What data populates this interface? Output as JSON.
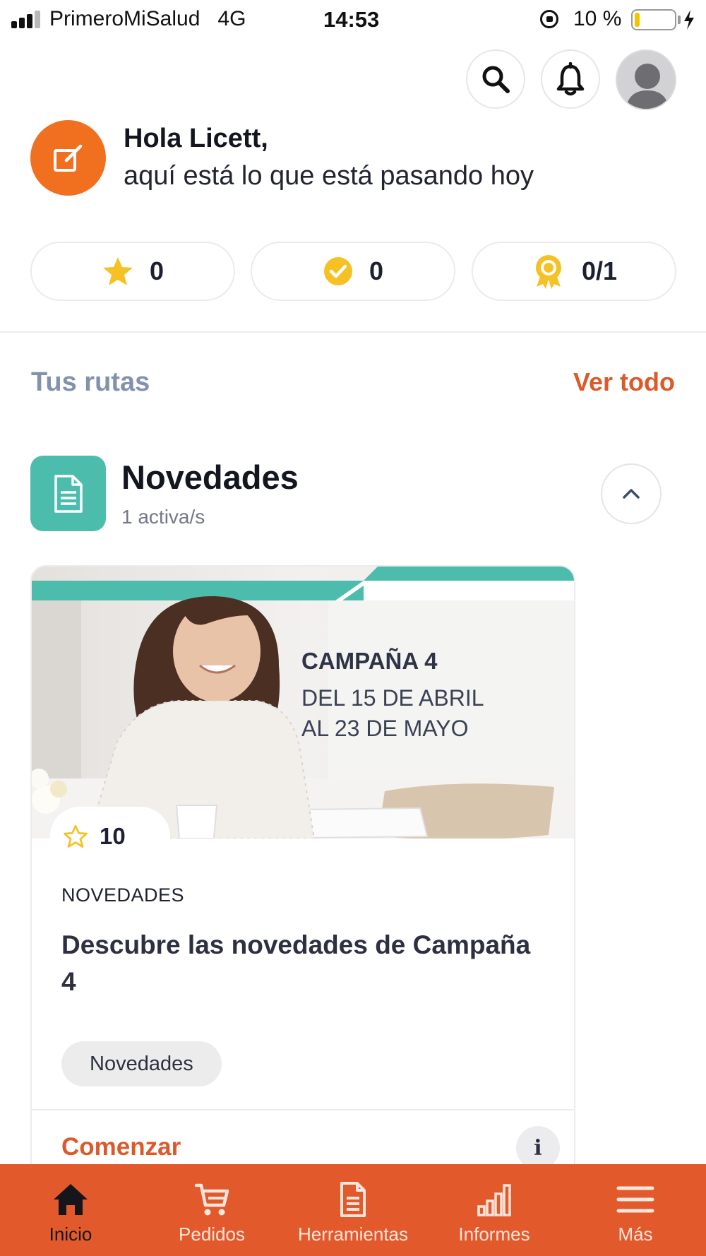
{
  "status_bar": {
    "carrier": "PrimeroMiSalud",
    "network": "4G",
    "time": "14:53",
    "battery_percent": "10 %",
    "battery_level": 0.1
  },
  "header": {
    "search_icon": "search-icon",
    "notifications_icon": "bell-icon",
    "avatar_icon": "user-avatar"
  },
  "greeting": {
    "title": "Hola Licett,",
    "subtitle": "aquí está lo que está pasando hoy",
    "badge_color": "#f07020"
  },
  "stats": [
    {
      "icon": "star-icon",
      "value": "0",
      "color": "#f5c125"
    },
    {
      "icon": "check-circle-icon",
      "value": "0",
      "color": "#f5c125"
    },
    {
      "icon": "award-icon",
      "value": "0/1",
      "color": "#f5c125"
    }
  ],
  "routes": {
    "title": "Tus rutas",
    "see_all": "Ver todo"
  },
  "section": {
    "title": "Novedades",
    "subtitle": "1 activa/s",
    "icon_color": "#4cbdad"
  },
  "card": {
    "banner": {
      "headline": "CAMPAÑA 4",
      "line1": "DEL 15 DE ABRIL",
      "line2": "AL 23 DE MAYO"
    },
    "points": "10",
    "category": "NOVEDADES",
    "title": "Descubre las novedades de Campaña 4",
    "tag": "Novedades",
    "cta": "Comenzar",
    "info": "i"
  },
  "bottom_nav": [
    {
      "label": "Inicio",
      "icon": "home-icon",
      "active": true
    },
    {
      "label": "Pedidos",
      "icon": "cart-icon",
      "active": false
    },
    {
      "label": "Herramientas",
      "icon": "document-icon",
      "active": false
    },
    {
      "label": "Informes",
      "icon": "bar-chart-icon",
      "active": false
    },
    {
      "label": "Más",
      "icon": "menu-icon",
      "active": false
    }
  ],
  "colors": {
    "accent": "#e2592c",
    "teal": "#4cbdad",
    "link": "#dc5a2a",
    "muted_title": "#8292ad"
  }
}
